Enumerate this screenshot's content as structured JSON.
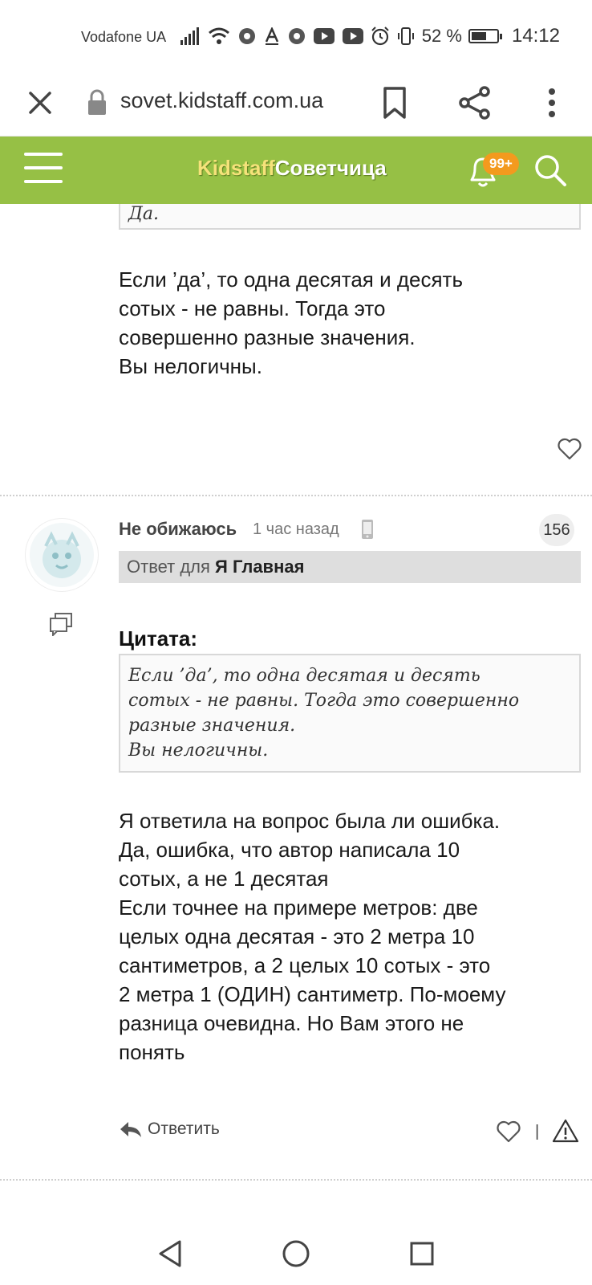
{
  "status_bar": {
    "carrier": "Vodafone UA",
    "battery_percent": "52 %",
    "battery_level": 0.52,
    "time": "14:12"
  },
  "browser": {
    "url": "sovet.kidstaff.com.ua",
    "icons": [
      "close-icon",
      "lock-icon",
      "bookmark-icon",
      "share-icon",
      "more-vert-icon"
    ]
  },
  "site_header": {
    "logo_part1": "Kidstaff",
    "logo_part2": "Советчица",
    "notifications_badge": "99+",
    "accent_color": "#96c045",
    "badge_color": "#f39a1e"
  },
  "post1": {
    "quote_tail": "Да.",
    "text": "Если ’да’, то одна десятая и десять\nсотых - не равны. Тогда это\nсовершенно разные значения.\nВы нелогичны."
  },
  "post2": {
    "author": "Не обижаюсь",
    "time_ago": "1 час назад",
    "count": "156",
    "reply_prefix": "Ответ для",
    "reply_to": "Я Главная",
    "quote_label": "Цитата:",
    "quote_text": "Если ’да’, то одна десятая и десять\nсотых - не равны. Тогда это совершенно\nразные значения.\nВы нелогичны.",
    "text": "Я ответила на вопрос была ли ошибка.\nДа, ошибка, что автор написала 10\nсотых, а не 1 десятая\nЕсли точнее на примере метров: две\nцелых одна десятая - это 2 метра 10\nсантиметров, а 2 целых 10 сотых - это\n2 метра 1 (ОДИН) сантиметр. По-моему\nразница очевидна. Но Вам этого не\nпонять",
    "reply_button": "Ответить",
    "separator": "|"
  }
}
